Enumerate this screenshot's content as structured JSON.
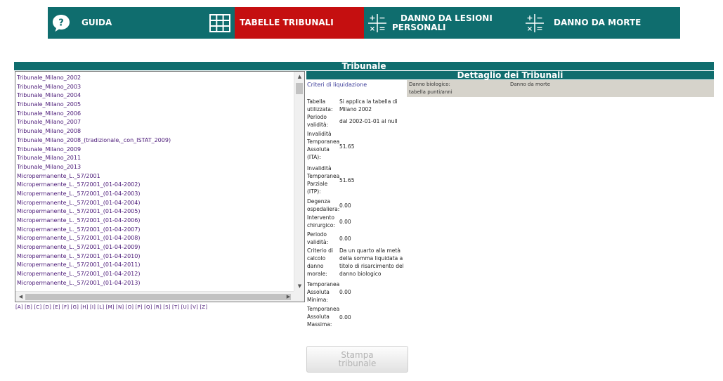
{
  "nav": {
    "guida": "GUIDA",
    "tabelle": "TABELLE TRIBUNALI",
    "lesioni_line1": "DANNO DA LESIONI",
    "lesioni_line2": "PERSONALI",
    "morte": "DANNO DA MORTE"
  },
  "bars": {
    "tribunale": "Tribunale",
    "dettaglio": "Dettaglio dei Tribunali"
  },
  "list": {
    "items": [
      "Tribunale_Milano_2002",
      "Tribunale_Milano_2003",
      "Tribunale_Milano_2004",
      "Tribunale_Milano_2005",
      "Tribunale_Milano_2006",
      "Tribunale_Milano_2007",
      "Tribunale_Milano_2008",
      "Tribunale_Milano_2008_(tradizionale,_con_ISTAT_2009)",
      "Tribunale_Milano_2009",
      "Tribunale_Milano_2011",
      "Tribunale_Milano_2013",
      "Micropermanente_L._57/2001",
      "Micropermanente_L._57/2001_(01-04-2002)",
      "Micropermanente_L._57/2001_(01-04-2003)",
      "Micropermanente_L._57/2001_(01-04-2004)",
      "Micropermanente_L._57/2001_(01-04-2005)",
      "Micropermanente_L._57/2001_(01-04-2006)",
      "Micropermanente_L._57/2001_(01-04-2007)",
      "Micropermanente_L._57/2001_(01-04-2008)",
      "Micropermanente_L._57/2001_(01-04-2009)",
      "Micropermanente_L._57/2001_(01-04-2010)",
      "Micropermanente_L._57/2001_(01-04-2011)",
      "Micropermanente_L._57/2001_(01-04-2012)",
      "Micropermanente_L._57/2001_(01-04-2013)"
    ],
    "letters": [
      "[A]",
      "[B]",
      "[C]",
      "[D]",
      "[E]",
      "[F]",
      "[G]",
      "[H]",
      "[I]",
      "[L]",
      "[M]",
      "[N]",
      "[O]",
      "[P]",
      "[Q]",
      "[R]",
      "[S]",
      "[T]",
      "[U]",
      "[V]",
      "[Z]"
    ]
  },
  "detail": {
    "criteri": "Criteri di liquidazione",
    "biologico_line1": "Danno biologico:",
    "biologico_line2": "tabella punti/anni",
    "morte": "Danno da morte",
    "rows": [
      {
        "label": "Tabella utilizzata:",
        "value": "Si applica la tabella di Milano 2002"
      },
      {
        "label": "Periodo validità:",
        "value": "dal 2002-01-01 al null"
      },
      {
        "label": "Invalidità Temporanea Assoluta (ITA):",
        "value": "51.65"
      },
      {
        "label": "Invalidità Temporanea Parziale (ITP):",
        "value": "51.65"
      },
      {
        "label": "Degenza ospedaliera:",
        "value": "0.00"
      },
      {
        "label": "Intervento chirurgico:",
        "value": "0.00"
      },
      {
        "label": "Periodo validità:",
        "value": "0.00"
      },
      {
        "label": "Criterio di calcolo danno morale:",
        "value": "Da un quarto alla metà della somma liquidata a titolo di risarcimento del danno biologico"
      },
      {
        "label": "Temporanea Assoluta Minima:",
        "value": "0.00"
      },
      {
        "label": "Temporanea Assoluta Massima:",
        "value": "0.00"
      }
    ]
  },
  "button": {
    "line1": "Stampa",
    "line2": "tribunale"
  }
}
